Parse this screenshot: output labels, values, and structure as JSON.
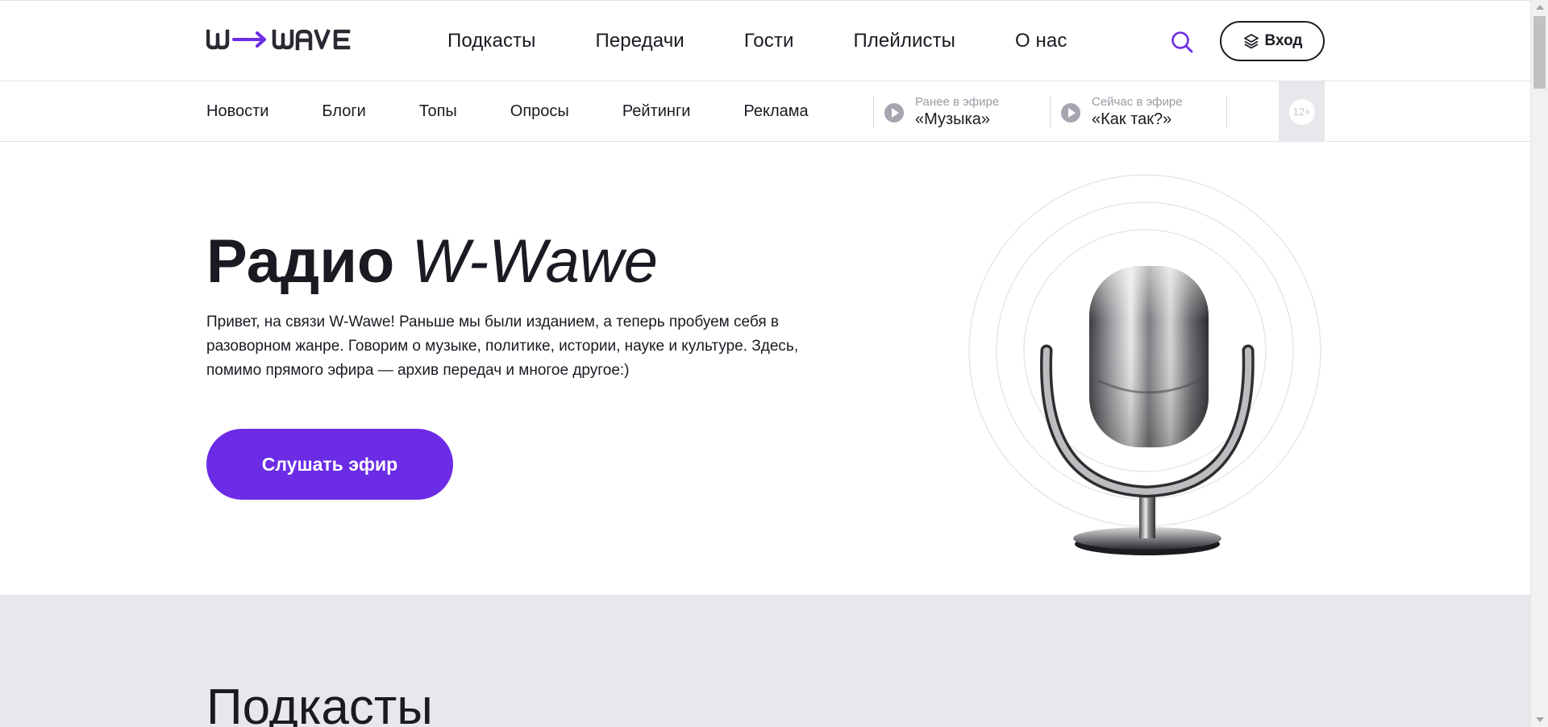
{
  "header": {
    "logo_text": "W→WAVE",
    "nav": [
      "Подкасты",
      "Передачи",
      "Гости",
      "Плейлисты",
      "О нас"
    ],
    "login_label": "Вход",
    "accent_color": "#6c2ce6"
  },
  "subnav": {
    "links": [
      "Новости",
      "Блоги",
      "Топы",
      "Опросы",
      "Рейтинги",
      "Реклама"
    ],
    "previous": {
      "caption": "Ранее в эфире",
      "title": "«Музыка»"
    },
    "current": {
      "caption": "Сейчас в эфире",
      "title": "«Как так?»"
    },
    "age_rating": "12+"
  },
  "hero": {
    "title_bold": "Радио",
    "title_italic": "W-Wawe",
    "text": "Привет, на связи W-Wawe! Раньше мы были изданием, а теперь пробуем себя в разоворном жанре. Говорим о музыке, политике, истории, науке и культуре. Здесь, помимо прямого эфира — архив передач и многое другое:)",
    "listen_button": "Слушать эфир",
    "button_color": "#6c2ce6"
  },
  "podcasts": {
    "heading": "Подкасты"
  },
  "icons": {
    "search": "search-icon",
    "login": "layers-icon",
    "play": "play-icon",
    "mic": "microphone-image"
  }
}
